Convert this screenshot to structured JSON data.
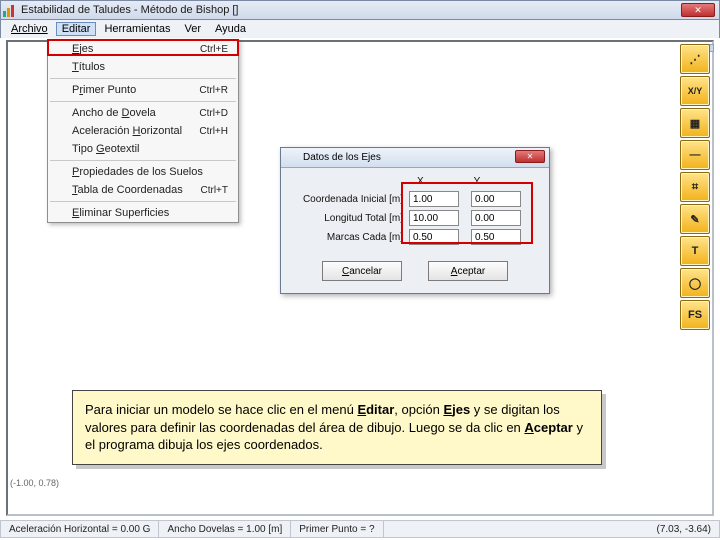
{
  "window": {
    "title": "Estabilidad de Taludes - Método de Bishop []",
    "close": "✕"
  },
  "menubar": {
    "archivo": "Archivo",
    "editar": "Editar",
    "herramientas": "Herramientas",
    "ver": "Ver",
    "ayuda": "Ayuda"
  },
  "dropdown": {
    "items": [
      {
        "label": "Ejes",
        "shortcut": "Ctrl+E"
      },
      {
        "label": "Títulos",
        "shortcut": ""
      },
      {
        "sep": true
      },
      {
        "label": "Primer Punto",
        "shortcut": "Ctrl+R"
      },
      {
        "sep": true
      },
      {
        "label": "Ancho de Dovela",
        "shortcut": "Ctrl+D"
      },
      {
        "label": "Aceleración Horizontal",
        "shortcut": "Ctrl+H"
      },
      {
        "label": "Tipo Geotextil",
        "shortcut": ""
      },
      {
        "sep": true
      },
      {
        "label": "Propiedades de los Suelos",
        "shortcut": ""
      },
      {
        "label": "Tabla de Coordenadas",
        "shortcut": "Ctrl+T"
      },
      {
        "sep": true
      },
      {
        "label": "Eliminar Superficies",
        "shortcut": ""
      }
    ]
  },
  "dialog": {
    "title": "Datos de los Ejes",
    "col_x": "X",
    "col_y": "Y",
    "rows": [
      {
        "label": "Coordenada Inicial [m]",
        "x": "1.00",
        "y": "0.00"
      },
      {
        "label": "Longitud Total [m]",
        "x": "10.00",
        "y": "0.00"
      },
      {
        "label": "Marcas Cada [m]",
        "x": "0.50",
        "y": "0.50"
      }
    ],
    "cancel": "Cancelar",
    "accept": "Aceptar"
  },
  "palette": {
    "btn1": "⋰",
    "btn2": "X/Y",
    "btn3": "▦",
    "btn4": "—",
    "btn5": "⌗",
    "btn6": "✎",
    "btn7": "T",
    "btn8": "◯",
    "btn9": "FS"
  },
  "smallstatus": "(-1.00, 0.78)",
  "statusbar": {
    "cell1": "Aceleración Horizontal = 0.00 G",
    "cell2": "Ancho Dovelas = 1.00 [m]",
    "cell3": "Primer Punto = ?",
    "cell4": "(7.03, -3.64)"
  },
  "note": {
    "p1a": "Para iniciar un modelo se hace clic en el menú ",
    "p1b": "E",
    "p1c": "ditar",
    "p1d": ", opción ",
    "p1e": "E",
    "p1f": "jes",
    "p1g": " y se digitan los valores para definir las coordenadas del área de dibujo. Luego se da clic en ",
    "p1h": "A",
    "p1i": "ceptar",
    "p1j": " y el programa dibuja los ejes coordenados."
  }
}
